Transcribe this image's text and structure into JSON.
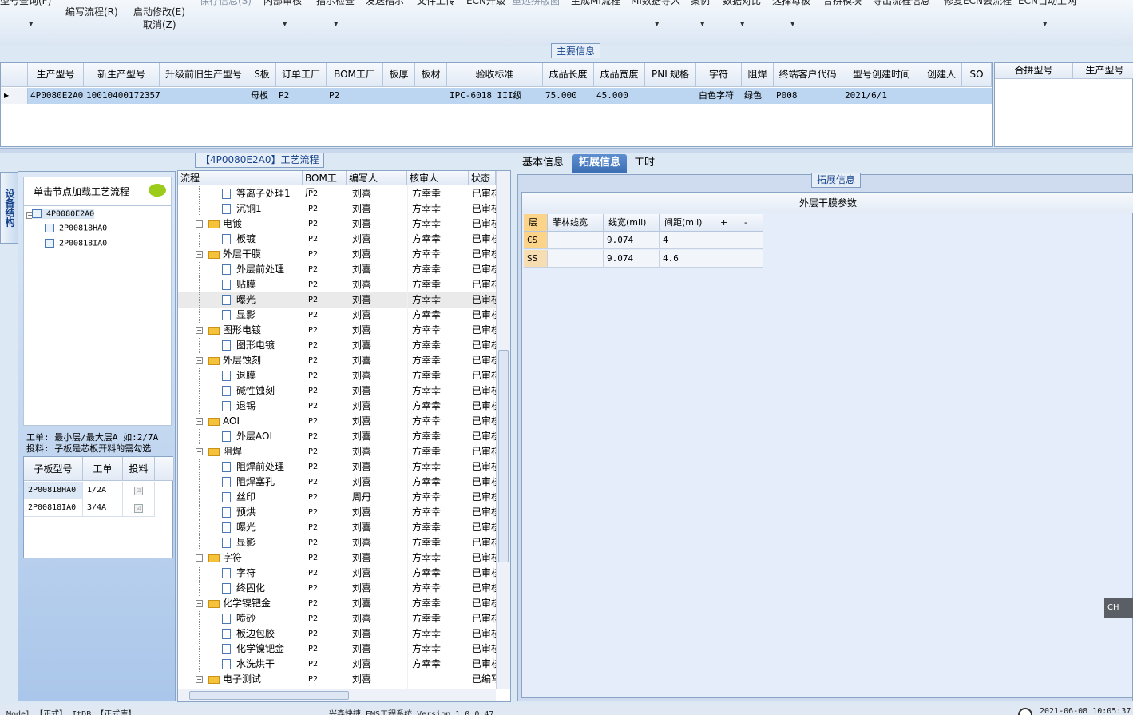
{
  "toolbar": {
    "items_top": [
      "型号查询(F)",
      "保存信息(S)",
      "内部审核",
      "指示检查",
      "发送指示",
      "文件上传",
      "ECN升级",
      "重选拼版图",
      "生成MI流程",
      "MI数据导入",
      "案例",
      "数据对比",
      "选择母板",
      "合拼模块",
      "导出流程信息",
      "修复ECN丢流程",
      "ECN自动上网"
    ],
    "write_flow": "编写流程(R)",
    "start_modify": "启动修改(E)",
    "cancel": "取消(Z)"
  },
  "main_info": {
    "title": "主要信息",
    "columns": [
      "生产型号",
      "新生产型号",
      "升级前旧生产型号",
      "S板",
      "订单工厂",
      "BOM工厂",
      "板厚",
      "板材",
      "验收标准",
      "成品长度",
      "成品宽度",
      "PNL规格",
      "字符",
      "阻焊",
      "终端客户代码",
      "型号创建时间",
      "创建人",
      "SO"
    ],
    "row": [
      "4P0080E2A0",
      "10010400172357",
      "",
      "母板",
      "P2",
      "P2",
      "",
      "",
      "IPC-6018 III级",
      "75.000",
      "45.000",
      "",
      "白色字符",
      "绿色",
      "P008",
      "2021/6/1",
      "",
      ""
    ],
    "right_columns": [
      "合拼型号",
      "生产型号"
    ]
  },
  "left": {
    "vertical_tab": "设备结构",
    "load_hint": "单击节点加载工艺流程",
    "tree": [
      "4P0080E2A0",
      "2P00818HA0",
      "2P00818IA0"
    ],
    "note_line1": "工单: 最小层/最大层A 如:2/7A",
    "note_line2": "投料: 子板是芯板开料的需勾选",
    "sub_columns": [
      "子板型号",
      "工单",
      "投料"
    ],
    "sub_rows": [
      {
        "model": "2P00818HA0",
        "order": "1/2A",
        "feed": "☑"
      },
      {
        "model": "2P00818IA0",
        "order": "3/4A",
        "feed": "☑"
      }
    ]
  },
  "process": {
    "title": "【4P0080E2A0】工艺流程",
    "columns": [
      "流程",
      "BOM工厂",
      "编写人",
      "核审人",
      "状态"
    ],
    "rows": [
      {
        "name": "等离子处理1",
        "lvl": 2,
        "bom": "P2",
        "writer": "刘喜",
        "reviewer": "方幸幸",
        "status": "已审核"
      },
      {
        "name": "沉铜1",
        "lvl": 2,
        "bom": "P2",
        "writer": "刘喜",
        "reviewer": "方幸幸",
        "status": "已审核"
      },
      {
        "name": "电镀",
        "lvl": 1,
        "bom": "P2",
        "writer": "刘喜",
        "reviewer": "方幸幸",
        "status": "已审核"
      },
      {
        "name": "板镀",
        "lvl": 2,
        "bom": "P2",
        "writer": "刘喜",
        "reviewer": "方幸幸",
        "status": "已审核"
      },
      {
        "name": "外层干膜",
        "lvl": 1,
        "bom": "P2",
        "writer": "刘喜",
        "reviewer": "方幸幸",
        "status": "已审核"
      },
      {
        "name": "外层前处理",
        "lvl": 2,
        "bom": "P2",
        "writer": "刘喜",
        "reviewer": "方幸幸",
        "status": "已审核"
      },
      {
        "name": "贴膜",
        "lvl": 2,
        "bom": "P2",
        "writer": "刘喜",
        "reviewer": "方幸幸",
        "status": "已审核"
      },
      {
        "name": "曝光",
        "lvl": 2,
        "bom": "P2",
        "writer": "刘喜",
        "reviewer": "方幸幸",
        "status": "已审核",
        "sel": true
      },
      {
        "name": "显影",
        "lvl": 2,
        "bom": "P2",
        "writer": "刘喜",
        "reviewer": "方幸幸",
        "status": "已审核"
      },
      {
        "name": "图形电镀",
        "lvl": 1,
        "bom": "P2",
        "writer": "刘喜",
        "reviewer": "方幸幸",
        "status": "已审核"
      },
      {
        "name": "图形电镀",
        "lvl": 2,
        "bom": "P2",
        "writer": "刘喜",
        "reviewer": "方幸幸",
        "status": "已审核"
      },
      {
        "name": "外层蚀刻",
        "lvl": 1,
        "bom": "P2",
        "writer": "刘喜",
        "reviewer": "方幸幸",
        "status": "已审核"
      },
      {
        "name": "退膜",
        "lvl": 2,
        "bom": "P2",
        "writer": "刘喜",
        "reviewer": "方幸幸",
        "status": "已审核"
      },
      {
        "name": "碱性蚀刻",
        "lvl": 2,
        "bom": "P2",
        "writer": "刘喜",
        "reviewer": "方幸幸",
        "status": "已审核"
      },
      {
        "name": "退锡",
        "lvl": 2,
        "bom": "P2",
        "writer": "刘喜",
        "reviewer": "方幸幸",
        "status": "已审核"
      },
      {
        "name": "AOI",
        "lvl": 1,
        "bom": "P2",
        "writer": "刘喜",
        "reviewer": "方幸幸",
        "status": "已审核"
      },
      {
        "name": "外层AOI",
        "lvl": 2,
        "bom": "P2",
        "writer": "刘喜",
        "reviewer": "方幸幸",
        "status": "已审核"
      },
      {
        "name": "阻焊",
        "lvl": 1,
        "bom": "P2",
        "writer": "刘喜",
        "reviewer": "方幸幸",
        "status": "已审核"
      },
      {
        "name": "阻焊前处理",
        "lvl": 2,
        "bom": "P2",
        "writer": "刘喜",
        "reviewer": "方幸幸",
        "status": "已审核"
      },
      {
        "name": "阻焊塞孔",
        "lvl": 2,
        "bom": "P2",
        "writer": "刘喜",
        "reviewer": "方幸幸",
        "status": "已审核"
      },
      {
        "name": "丝印",
        "lvl": 2,
        "bom": "P2",
        "writer": "周丹",
        "reviewer": "方幸幸",
        "status": "已审核"
      },
      {
        "name": "预烘",
        "lvl": 2,
        "bom": "P2",
        "writer": "刘喜",
        "reviewer": "方幸幸",
        "status": "已审核"
      },
      {
        "name": "曝光",
        "lvl": 2,
        "bom": "P2",
        "writer": "刘喜",
        "reviewer": "方幸幸",
        "status": "已审核"
      },
      {
        "name": "显影",
        "lvl": 2,
        "bom": "P2",
        "writer": "刘喜",
        "reviewer": "方幸幸",
        "status": "已审核"
      },
      {
        "name": "字符",
        "lvl": 1,
        "bom": "P2",
        "writer": "刘喜",
        "reviewer": "方幸幸",
        "status": "已审核"
      },
      {
        "name": "字符",
        "lvl": 2,
        "bom": "P2",
        "writer": "刘喜",
        "reviewer": "方幸幸",
        "status": "已审核"
      },
      {
        "name": "终固化",
        "lvl": 2,
        "bom": "P2",
        "writer": "刘喜",
        "reviewer": "方幸幸",
        "status": "已审核"
      },
      {
        "name": "化学镍钯金",
        "lvl": 1,
        "bom": "P2",
        "writer": "刘喜",
        "reviewer": "方幸幸",
        "status": "已审核"
      },
      {
        "name": "喷砂",
        "lvl": 2,
        "bom": "P2",
        "writer": "刘喜",
        "reviewer": "方幸幸",
        "status": "已审核"
      },
      {
        "name": "板边包胶",
        "lvl": 2,
        "bom": "P2",
        "writer": "刘喜",
        "reviewer": "方幸幸",
        "status": "已审核"
      },
      {
        "name": "化学镍钯金",
        "lvl": 2,
        "bom": "P2",
        "writer": "刘喜",
        "reviewer": "方幸幸",
        "status": "已审核"
      },
      {
        "name": "水洗烘干",
        "lvl": 2,
        "bom": "P2",
        "writer": "刘喜",
        "reviewer": "方幸幸",
        "status": "已审核"
      },
      {
        "name": "电子测试",
        "lvl": 1,
        "bom": "P2",
        "writer": "刘喜",
        "reviewer": "",
        "status": "已编写"
      }
    ]
  },
  "right": {
    "tabs": [
      "基本信息",
      "拓展信息",
      "工时"
    ],
    "active_tab": "拓展信息",
    "ext_title": "拓展信息",
    "section_title": "外层干膜参数",
    "columns": [
      "层",
      "菲林线宽",
      "线宽(mil)",
      "间距(mil)",
      "+",
      "-"
    ],
    "rows": [
      {
        "layer": "CS",
        "film": "",
        "width": "9.074",
        "spacing": "4"
      },
      {
        "layer": "SS",
        "film": "",
        "width": "9.074",
        "spacing": "4.6"
      }
    ]
  },
  "ime": "CH",
  "status": {
    "left": "Model 【正式】 ItDB 【正式库】",
    "center": "兴森快捷 EMS工程系统 Version 1.0.0.47",
    "right": "2021-06-08 10:05:37"
  }
}
